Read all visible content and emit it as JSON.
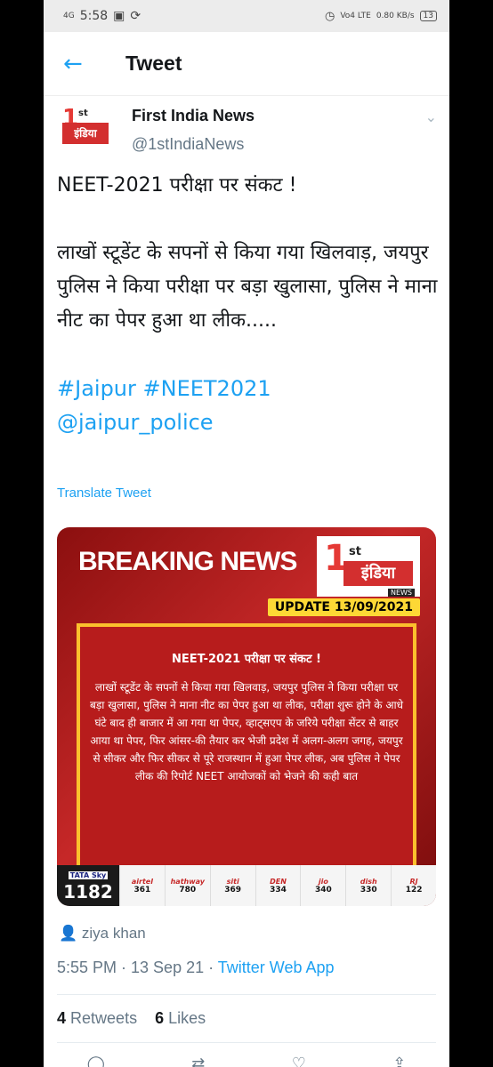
{
  "status_bar": {
    "network": "4G",
    "time": "5:58",
    "volte": "Vo4 LTE",
    "speed": "0.80 KB/s",
    "battery": "13"
  },
  "header": {
    "title": "Tweet"
  },
  "author": {
    "name": "First India News",
    "handle": "@1stIndiaNews",
    "avatar_text": "इंडिया"
  },
  "tweet": {
    "line1": "NEET-2021 परीक्षा पर संकट !",
    "line2": "लाखों स्टूडेंट के सपनों से किया गया खिलवाड़, जयपुर पुलिस ने किया परीक्षा पर बड़ा खुलासा, पुलिस ने माना नीट का पेपर हुआ था लीक.....",
    "hashtags": "#Jaipur #NEET2021",
    "mention": "@jaipur_police",
    "translate": "Translate Tweet"
  },
  "media": {
    "headline": "BREAKING NEWS",
    "logo_1": "1",
    "logo_st": "st",
    "logo_india": "इंडिया",
    "logo_news": "NEWS",
    "update": "UPDATE 13/09/2021",
    "panel_title": "NEET-2021 परीक्षा पर संकट !",
    "panel_text": "लाखों स्टूडेंट के सपनों से किया गया खिलवाड़, जयपुर पुलिस ने किया परीक्षा पर बड़ा खुलासा, पुलिस ने माना नीट का पेपर हुआ था लीक, परीक्षा शुरू होने के आधे घंटे बाद ही बाजार में आ गया था पेपर, व्हाट्सएप के जरिये परीक्षा सेंटर से बाहर आया था पेपर, फिर आंसर-की तैयार कर भेजी प्रदेश में अलग-अलग जगह, जयपुर से सीकर और फिर सीकर से पूरे राजस्थान में हुआ पेपर लीक, अब पुलिस ने पेपर लीक की रिपोर्ट NEET आयोजकों को भेजने की कही बात",
    "tata_label": "TATA Sky",
    "tata_number": "1182",
    "channels": [
      {
        "logo": "airtel",
        "number": "361"
      },
      {
        "logo": "hathway",
        "number": "780"
      },
      {
        "logo": "siti",
        "number": "369"
      },
      {
        "logo": "DEN",
        "number": "334"
      },
      {
        "logo": "jio",
        "number": "340"
      },
      {
        "logo": "dish",
        "number": "330"
      },
      {
        "logo": "RJ",
        "number": "122"
      }
    ]
  },
  "byline": "ziya khan",
  "meta": {
    "time": "5:55 PM · 13 Sep 21 · ",
    "app": "Twitter Web App"
  },
  "stats": {
    "retweets_count": "4",
    "retweets_label": "Retweets",
    "likes_count": "6",
    "likes_label": "Likes"
  }
}
